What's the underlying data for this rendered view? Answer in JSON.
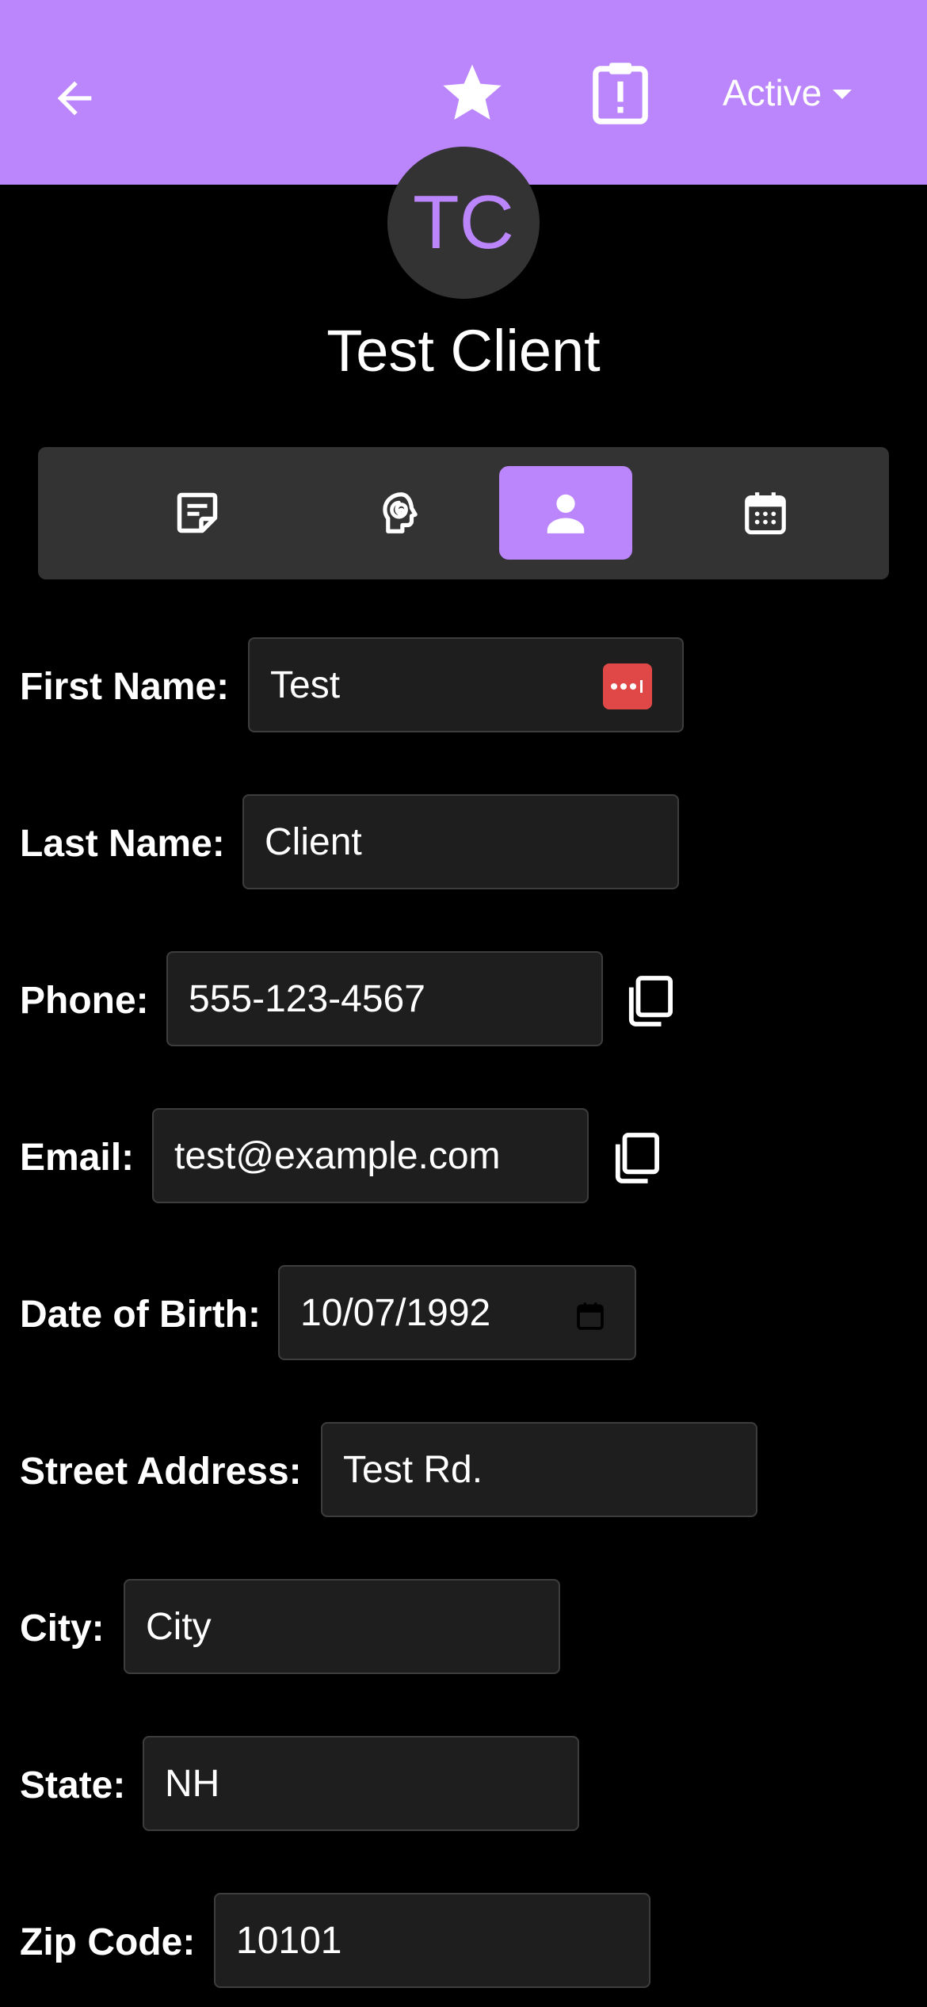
{
  "header": {
    "back_icon": "arrow-left-icon",
    "favorite_icon": "star-icon",
    "clipboard_icon": "clipboard-alert-icon",
    "status_label": "Active",
    "accent_color": "#bb86fc"
  },
  "client": {
    "initials": "TC",
    "name": "Test Client"
  },
  "tabs": [
    {
      "icon": "note-icon",
      "active": false
    },
    {
      "icon": "head-spiral-icon",
      "active": false
    },
    {
      "icon": "person-icon",
      "active": true
    },
    {
      "icon": "calendar-icon",
      "active": false
    }
  ],
  "form": {
    "first_name": {
      "label": "First Name:",
      "value": "Test"
    },
    "last_name": {
      "label": "Last Name:",
      "value": "Client"
    },
    "phone": {
      "label": "Phone:",
      "value": "555-123-4567"
    },
    "email": {
      "label": "Email:",
      "value": "test@example.com"
    },
    "dob": {
      "label": "Date of Birth:",
      "value": "10/07/1992"
    },
    "street": {
      "label": "Street Address:",
      "value": "Test Rd."
    },
    "city": {
      "label": "City:",
      "value": "City"
    },
    "state": {
      "label": "State:",
      "value": "NH"
    },
    "zip": {
      "label": "Zip Code:",
      "value": "10101"
    }
  }
}
